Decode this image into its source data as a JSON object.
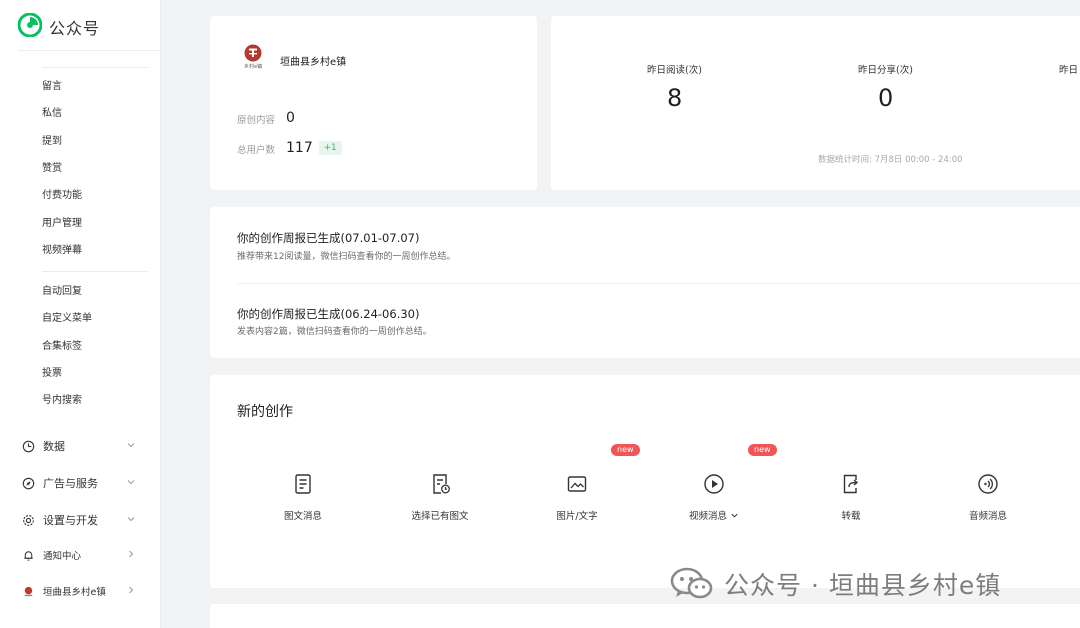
{
  "brand": {
    "name": "公众号",
    "icon": "wechat-mp-logo-icon"
  },
  "sidebar": {
    "group1": [
      "留言",
      "私信",
      "提到",
      "赞赏",
      "付费功能",
      "用户管理",
      "视频弹幕"
    ],
    "group2": [
      "自动回复",
      "自定义菜单",
      "合集标签",
      "投票",
      "号内搜索"
    ],
    "main": [
      {
        "label": "数据",
        "icon": "clock-icon"
      },
      {
        "label": "广告与服务",
        "icon": "compass-icon"
      },
      {
        "label": "设置与开发",
        "icon": "gear-icon"
      },
      {
        "label": "通知中心",
        "icon": "bell-icon"
      },
      {
        "label": "垣曲县乡村e镇",
        "icon": "account-avatar-icon"
      }
    ]
  },
  "account": {
    "avatar_text": "乡村e镇",
    "name": "垣曲县乡村e镇",
    "original_label": "原创内容",
    "original_value": "0",
    "users_label": "总用户数",
    "users_value": "117",
    "users_delta": "+1"
  },
  "metrics": {
    "items": [
      {
        "label": "昨日阅读(次)",
        "value": "8"
      },
      {
        "label": "昨日分享(次)",
        "value": "0"
      },
      {
        "label": "昨日"
      }
    ],
    "stat_time": "数据统计时间: 7月8日 00:00 - 24:00"
  },
  "reports": [
    {
      "title": "你的创作周报已生成(07.01-07.07)",
      "sub": "推荐带来12阅读量，微信扫码查看你的一周创作总结。"
    },
    {
      "title": "你的创作周报已生成(06.24-06.30)",
      "sub": "发表内容2篇，微信扫码查看你的一周创作总结。"
    }
  ],
  "create": {
    "title": "新的创作",
    "items": [
      {
        "label": "图文消息",
        "icon": "document-icon"
      },
      {
        "label": "选择已有图文",
        "icon": "document-clock-icon"
      },
      {
        "label": "图片/文字",
        "icon": "image-icon",
        "badge": "new"
      },
      {
        "label": "视频消息",
        "icon": "play-circle-icon",
        "badge": "new"
      },
      {
        "label": "转载",
        "icon": "repost-icon"
      },
      {
        "label": "音频消息",
        "icon": "audio-icon"
      }
    ]
  },
  "watermark": {
    "text": "公众号 · 垣曲县乡村e镇",
    "icon": "wechat-logo-icon"
  },
  "colors": {
    "accent_green": "#07c160",
    "badge_red": "#f25555",
    "background": "#f2f3f5"
  }
}
